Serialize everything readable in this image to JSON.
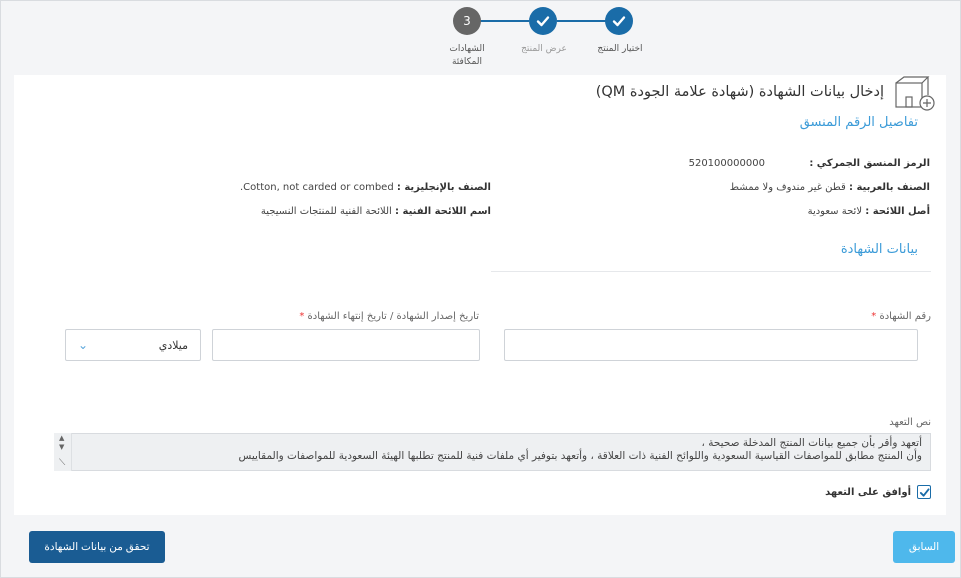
{
  "stepper": {
    "steps": [
      {
        "label": "اختيار المنتج",
        "state": "done"
      },
      {
        "label": "عرض المنتج",
        "state": "done"
      },
      {
        "label_line1": "الشهادات",
        "label_line2": "المكافئة",
        "number": "3",
        "state": "current"
      }
    ]
  },
  "page": {
    "title": "إدخال بيانات الشهادة (شهادة علامة الجودة QM)"
  },
  "hs_section": {
    "title": "تفاصيل الرقم المنسق",
    "hs_code_label": "الرمز المنسق الجمركي :",
    "hs_code_value": "520100000000",
    "class_ar_label": "الصنف بالعربية :",
    "class_ar_value": "قطن غير مندوف ولا ممشط",
    "class_en_label": "الصنف بالإنجليزية :",
    "class_en_value": "Cotton, not carded or combed.",
    "reg_origin_label": "أصل اللائحة :",
    "reg_origin_value": "لائحة سعودية",
    "reg_name_label": "اسم اللائحة الفنية :",
    "reg_name_value": "اللائحة الفنية للمنتجات النسيجية"
  },
  "cert_section": {
    "title": "بيانات الشهادة",
    "cert_number_label": "رقم الشهادة",
    "dates_label": "تاريخ إصدار الشهادة / تاريخ إنتهاء الشهادة",
    "required_mark": "*",
    "cert_number_value": "",
    "dates_value": "",
    "calendar_select": "ميلادي"
  },
  "pledge": {
    "label": "نص التعهد",
    "line1": "أتعهد وأقر بأن جميع بيانات المنتج المدخلة صحيحة ،",
    "line2": "وأن المنتج مطابق للمواصفات القياسية السعودية واللوائح الفنية ذات العلاقة ، وأتعهد بتوفير أي ملفات فنية للمنتج تطلبها الهيئة السعودية للمواصفات والمقاييس",
    "agree_label": "أوافق على التعهد",
    "agreed": true
  },
  "footer": {
    "prev_label": "السابق",
    "verify_label": "تحقق من بيانات الشهادة"
  },
  "colors": {
    "primary": "#1a6ca8",
    "accent": "#3b9bd8",
    "step_current": "#666666",
    "btn_prev": "#4eb8ec",
    "btn_verify": "#1a5c93"
  }
}
